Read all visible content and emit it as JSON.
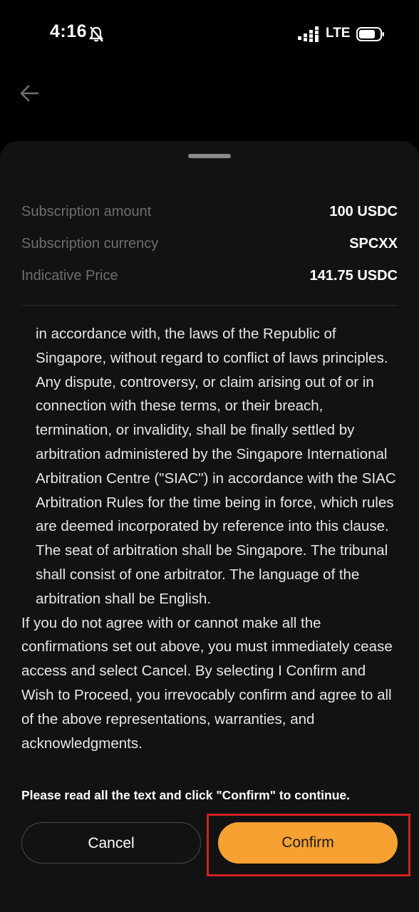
{
  "status_bar": {
    "time": "4:16",
    "network": "LTE",
    "icons": [
      "bell-off-icon",
      "signal-icon",
      "battery-icon"
    ]
  },
  "nav": {
    "back_icon": "arrow-left-icon"
  },
  "summary": [
    {
      "label": "Subscription amount",
      "value": "100 USDC"
    },
    {
      "label": "Subscription currency",
      "value": "SPCXX"
    },
    {
      "label": "Indicative Price",
      "value": "141.75 USDC"
    }
  ],
  "terms": {
    "clause": "in accordance with, the laws of the Republic of Singapore, without regard to conflict of laws principles. Any dispute, controversy, or claim arising out of or in connection with these terms, or their breach, termination, or invalidity, shall be finally settled by arbitration administered by the Singapore International Arbitration Centre (\"SIAC\") in accordance with the SIAC Arbitration Rules for the time being in force, which rules are deemed incorporated by reference into this clause. The seat of arbitration shall be Singapore. The tribunal shall consist of one arbitrator. The language of the arbitration shall be English.",
    "closing": "If you do not agree with or cannot make all the confirmations set out above, you must immediately cease access and select Cancel. By selecting I Confirm and Wish to Proceed, you irrevocably confirm and agree to all of the above representations, warranties, and acknowledgments."
  },
  "notice": "Please read all the text and click \"Confirm\" to continue.",
  "buttons": {
    "cancel": "Cancel",
    "confirm": "Confirm"
  },
  "colors": {
    "background": "#000000",
    "sheet": "#121212",
    "accent": "#f7a133",
    "highlight": "#d42121"
  }
}
